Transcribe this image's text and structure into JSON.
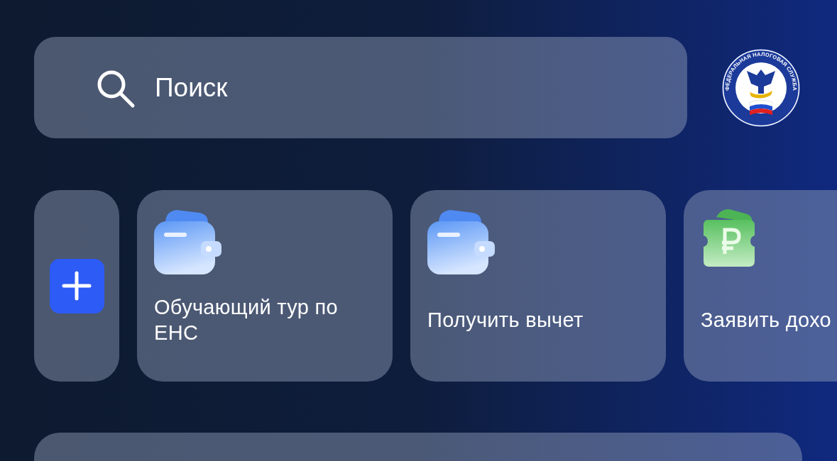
{
  "search": {
    "placeholder": "Поиск"
  },
  "logo": {
    "text": "ФЕДЕРАЛЬНАЯ НАЛОГОВАЯ СЛУЖБА"
  },
  "shortcuts": [
    {
      "kind": "wallet",
      "label": "Обучающий тур по ЕНС"
    },
    {
      "kind": "wallet",
      "label": "Получить вычет"
    },
    {
      "kind": "ruble",
      "label": "Заявить дохо"
    }
  ]
}
